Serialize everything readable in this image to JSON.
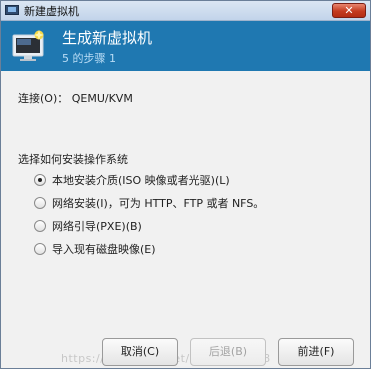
{
  "window": {
    "title": "新建虚拟机",
    "close_label": "✕"
  },
  "header": {
    "title": "生成新虚拟机",
    "step": "5 的步骤 1"
  },
  "connection": {
    "text": "连接(O)： QEMU/KVM"
  },
  "install": {
    "question": "选择如何安装操作系统",
    "options": [
      {
        "label": "本地安装介质(ISO 映像或者光驱)(L)",
        "checked": true
      },
      {
        "label": "网络安装(I)，可为 HTTP、FTP 或者 NFS。",
        "checked": false
      },
      {
        "label": "网络引导(PXE)(B)",
        "checked": false
      },
      {
        "label": "导入现有磁盘映像(E)",
        "checked": false
      }
    ]
  },
  "buttons": {
    "cancel": "取消(C)",
    "back": "后退(B)",
    "forward": "前进(F)"
  },
  "watermark": "https://blog.csdn.net/qq_40123128",
  "colors": {
    "header_bg": "#1f78b1",
    "close_bg": "#c43b20"
  }
}
